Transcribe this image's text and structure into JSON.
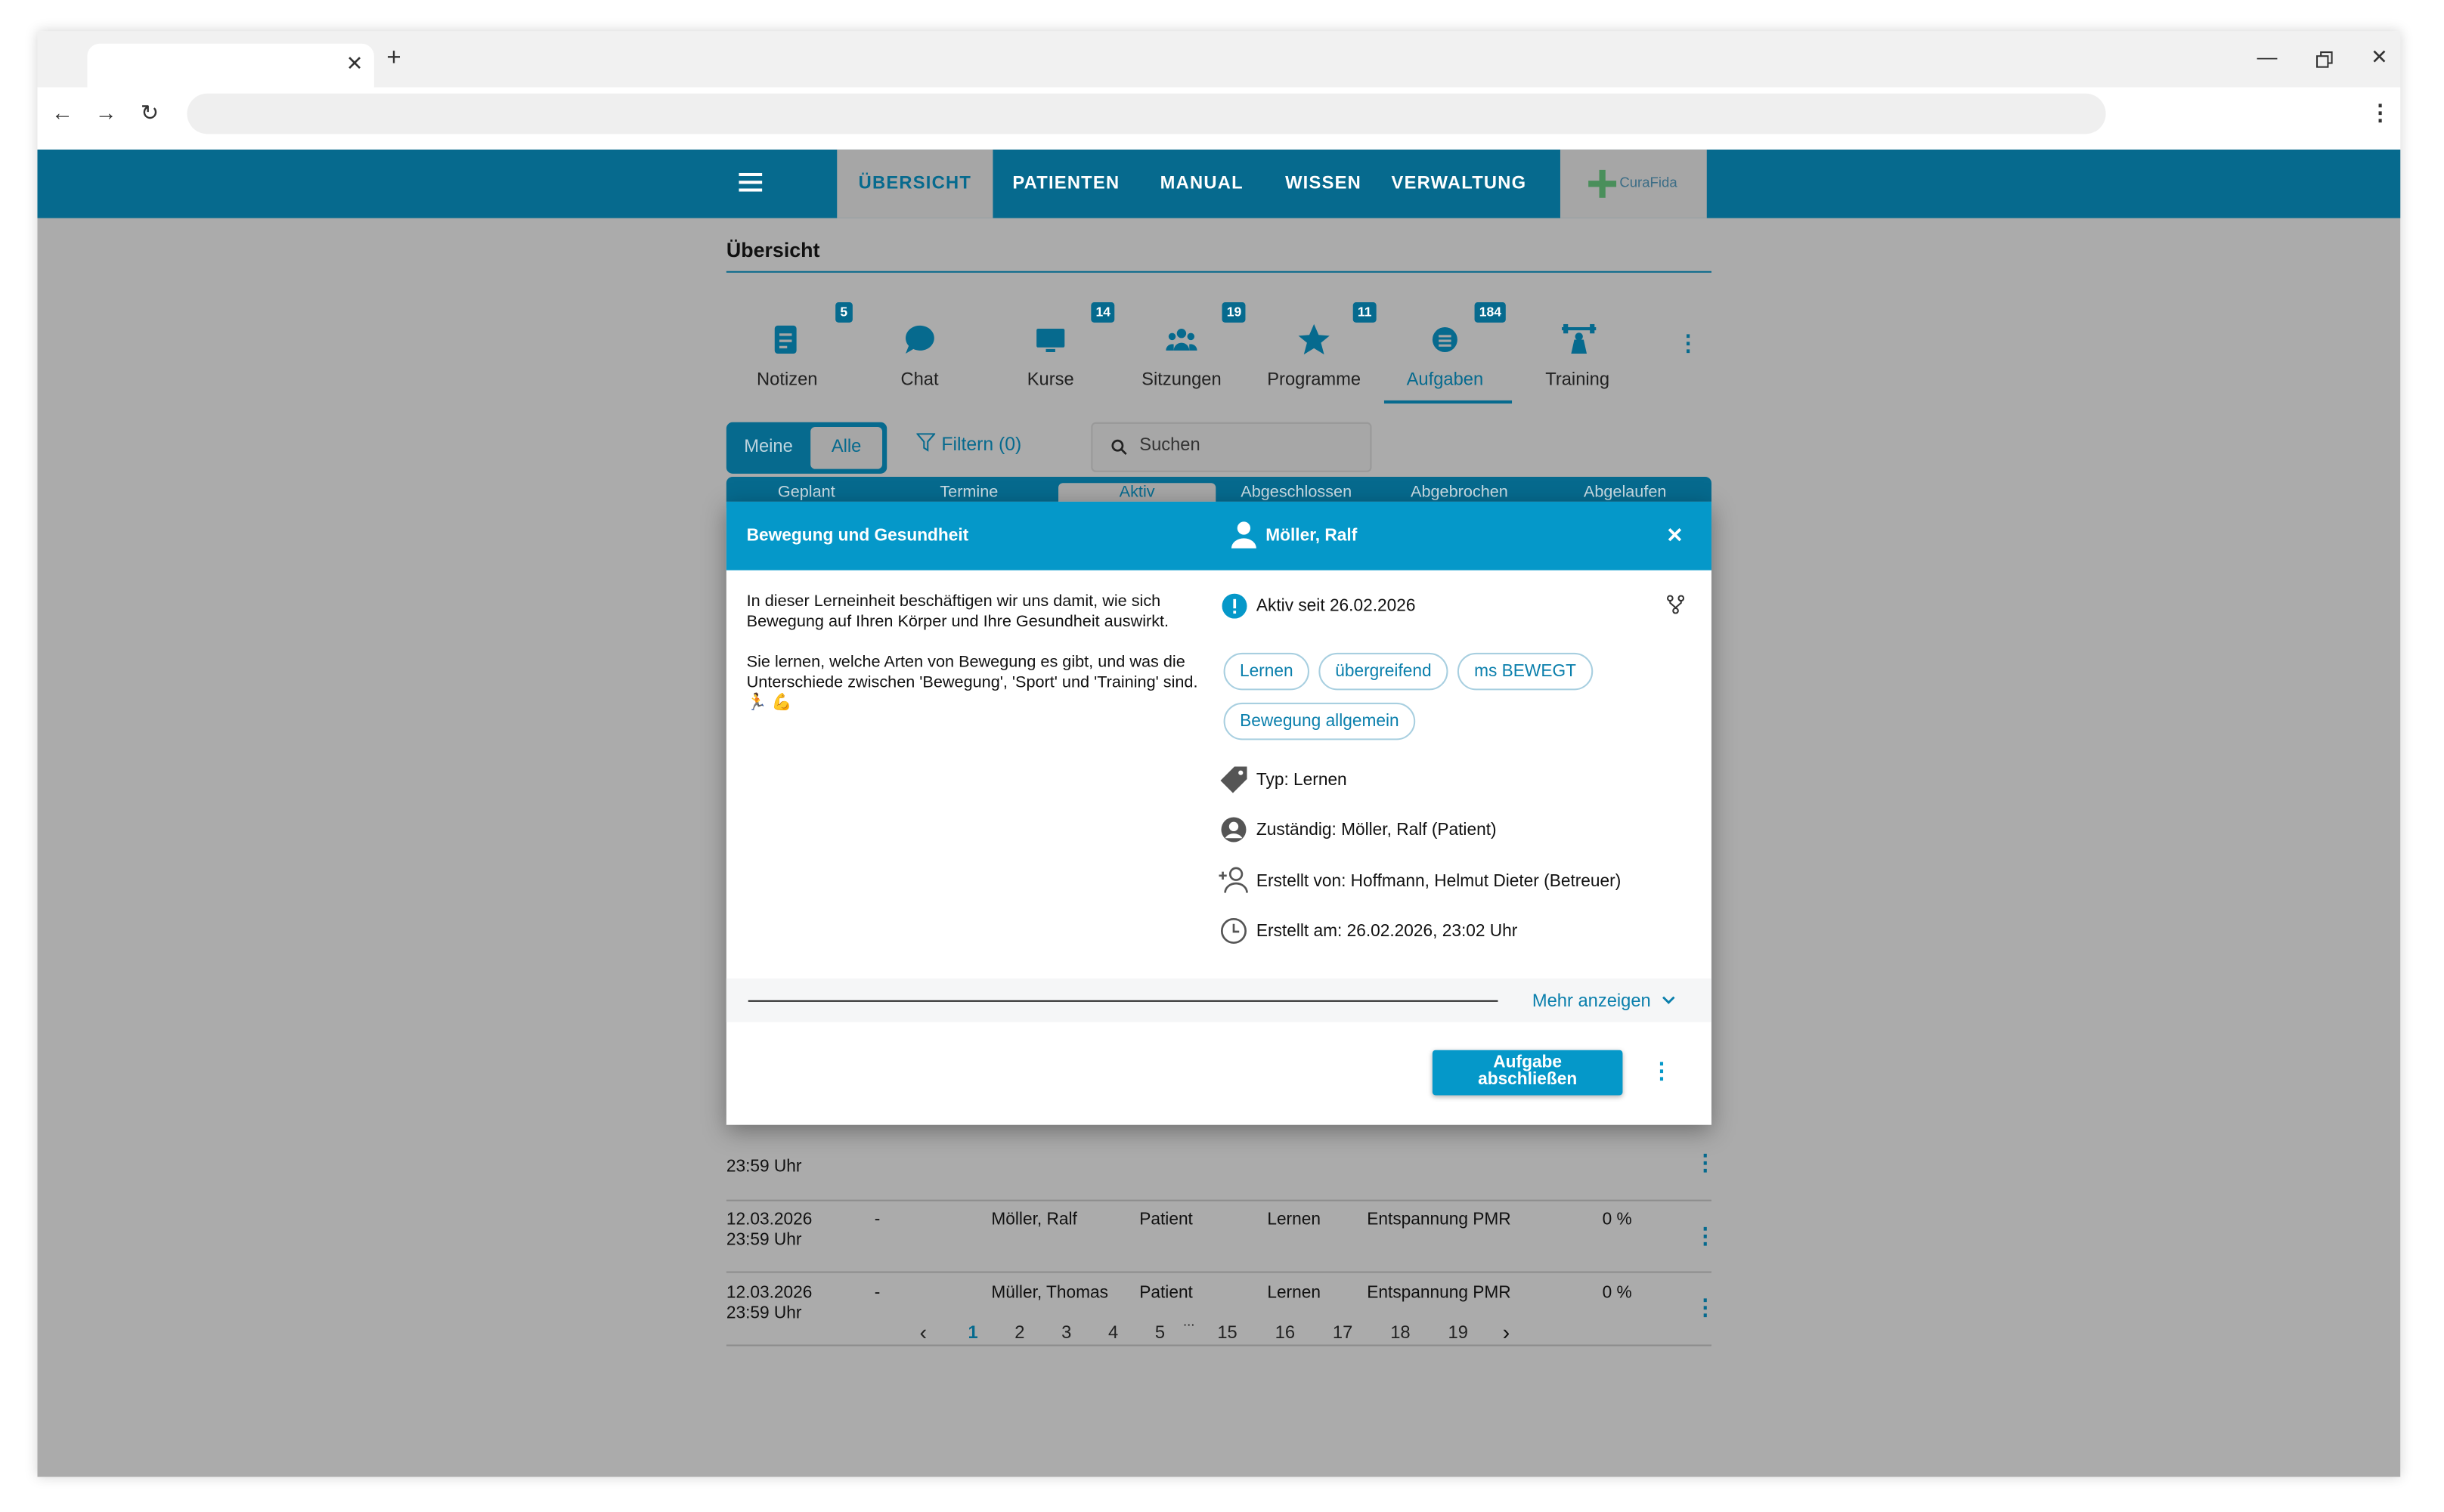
{
  "nav": {
    "items": [
      "ÜBERSICHT",
      "PATIENTEN",
      "MANUAL",
      "WISSEN",
      "VERWALTUNG"
    ],
    "logo_text": "CuraFida"
  },
  "page": {
    "title": "Übersicht"
  },
  "categories": [
    {
      "label": "Notizen",
      "badge": "5"
    },
    {
      "label": "Chat",
      "badge": ""
    },
    {
      "label": "Kurse",
      "badge": "14"
    },
    {
      "label": "Sitzungen",
      "badge": "19"
    },
    {
      "label": "Programme",
      "badge": "11"
    },
    {
      "label": "Aufgaben",
      "badge": "184"
    },
    {
      "label": "Training",
      "badge": ""
    }
  ],
  "toggle": {
    "meine": "Meine",
    "alle": "Alle"
  },
  "filter": {
    "label": "Filtern (0)"
  },
  "search": {
    "placeholder": "Suchen"
  },
  "status_tabs": [
    "Geplant",
    "Termine",
    "Aktiv",
    "Abgeschlossen",
    "Abgebrochen",
    "Abgelaufen"
  ],
  "table": {
    "partial_row": {
      "date_line2": "23:59 Uhr"
    },
    "rows": [
      {
        "date": "12.03.2026",
        "time": "23:59 Uhr",
        "dash": "-",
        "name": "Möller, Ralf",
        "role": "Patient",
        "type": "Lernen",
        "topic": "Entspannung PMR",
        "progress": "0 %"
      },
      {
        "date": "12.03.2026",
        "time": "23:59 Uhr",
        "dash": "-",
        "name": "Müller, Thomas",
        "role": "Patient",
        "type": "Lernen",
        "topic": "Entspannung PMR",
        "progress": "0 %"
      }
    ]
  },
  "pagination": {
    "pages": [
      "1",
      "2",
      "3",
      "4",
      "5",
      "...",
      "15",
      "16",
      "17",
      "18",
      "19"
    ],
    "current": "1"
  },
  "dialog": {
    "title": "Bewegung und Gesundheit",
    "patient": "Möller, Ralf",
    "description_1": "In dieser Lerneinheit beschäftigen wir uns damit, wie sich Bewegung auf Ihren Körper und Ihre Gesundheit auswirkt.",
    "description_2": "Sie lernen, welche Arten von Bewegung es gibt, und was die Unterschiede zwischen 'Bewegung', 'Sport' und 'Training' sind. 🏃 💪",
    "status": "Aktiv seit 26.02.2026",
    "chips": [
      "Lernen",
      "übergreifend",
      "ms BEWEGT",
      "Bewegung allgemein"
    ],
    "type": "Typ: Lernen",
    "responsible": "Zuständig: Möller, Ralf (Patient)",
    "created_by": "Erstellt von: Hoffmann, Helmut Dieter (Betreuer)",
    "created_at": "Erstellt am: 26.02.2026, 23:02 Uhr",
    "more": "Mehr anzeigen",
    "complete_line1": "Aufgabe",
    "complete_line2": "abschließen"
  },
  "colors": {
    "primary": "#066a8e",
    "accent": "#0598c9",
    "overlay": "#ababab"
  }
}
